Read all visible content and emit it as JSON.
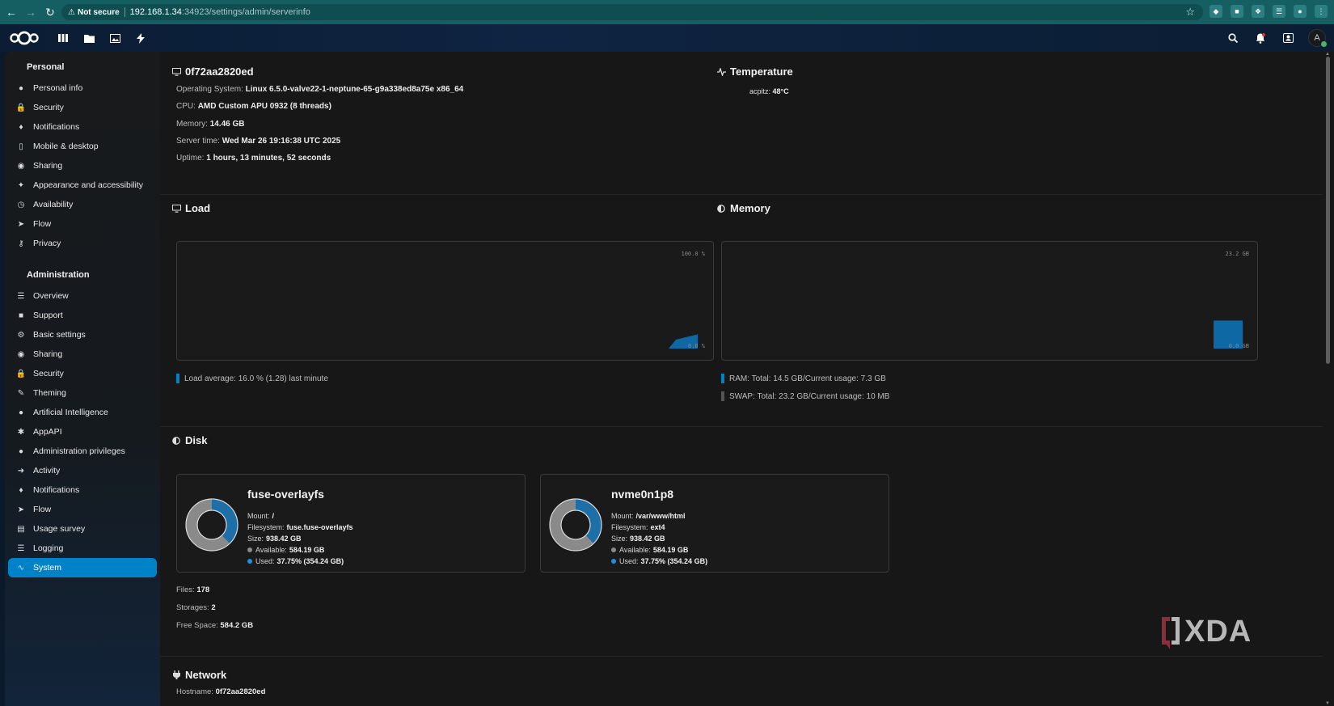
{
  "browser": {
    "security_label": "Not secure",
    "url_host": "192.168.1.34",
    "url_path": ":34923/settings/admin/serverinfo"
  },
  "header": {
    "user_initial": "A"
  },
  "sidebar": {
    "personal_title": "Personal",
    "personal_items": [
      {
        "label": "Personal info",
        "icon": "user-icon"
      },
      {
        "label": "Security",
        "icon": "lock-icon"
      },
      {
        "label": "Notifications",
        "icon": "bell-icon"
      },
      {
        "label": "Mobile & desktop",
        "icon": "phone-icon"
      },
      {
        "label": "Sharing",
        "icon": "share-icon"
      },
      {
        "label": "Appearance and accessibility",
        "icon": "accessibility-icon"
      },
      {
        "label": "Availability",
        "icon": "clock-icon"
      },
      {
        "label": "Flow",
        "icon": "flow-icon"
      },
      {
        "label": "Privacy",
        "icon": "key-icon"
      }
    ],
    "admin_title": "Administration",
    "admin_items": [
      {
        "label": "Overview",
        "icon": "sliders-icon"
      },
      {
        "label": "Support",
        "icon": "chat-icon"
      },
      {
        "label": "Basic settings",
        "icon": "gear-icon"
      },
      {
        "label": "Sharing",
        "icon": "share-icon"
      },
      {
        "label": "Security",
        "icon": "lock-icon"
      },
      {
        "label": "Theming",
        "icon": "brush-icon"
      },
      {
        "label": "Artificial Intelligence",
        "icon": "robot-icon"
      },
      {
        "label": "AppAPI",
        "icon": "api-icon"
      },
      {
        "label": "Administration privileges",
        "icon": "admin-user-icon"
      },
      {
        "label": "Activity",
        "icon": "bolt-icon"
      },
      {
        "label": "Notifications",
        "icon": "bell-icon"
      },
      {
        "label": "Flow",
        "icon": "flow-icon"
      },
      {
        "label": "Usage survey",
        "icon": "chart-icon"
      },
      {
        "label": "Logging",
        "icon": "list-icon"
      },
      {
        "label": "System",
        "icon": "pulse-icon",
        "active": true
      }
    ]
  },
  "system": {
    "hostname": "0f72aa2820ed",
    "os_label": "Operating System:",
    "os_value": "Linux 6.5.0-valve22-1-neptune-65-g9a338ed8a75e x86_64",
    "cpu_label": "CPU:",
    "cpu_value": "AMD Custom APU 0932 (8 threads)",
    "memory_label": "Memory:",
    "memory_value": "14.46 GB",
    "time_label": "Server time:",
    "time_value": "Wed Mar 26 19:16:38 UTC 2025",
    "uptime_label": "Uptime:",
    "uptime_value": "1 hours, 13 minutes, 52 seconds"
  },
  "temperature": {
    "title": "Temperature",
    "sensor_label": "acpitz:",
    "sensor_value": "48°C"
  },
  "load": {
    "title": "Load",
    "max_label": "100.0 %",
    "min_label": "0.0 %",
    "legend": "Load average: 16.0 % (1.28) last minute",
    "color": "#0082c9"
  },
  "memory": {
    "title": "Memory",
    "max_label": "23.2 GB",
    "min_label": "0.0 GB",
    "ram_legend": "RAM: Total: 14.5 GB/Current usage: 7.3 GB",
    "swap_legend": "SWAP: Total: 23.2 GB/Current usage: 10 MB",
    "ram_color": "#0082c9",
    "swap_color": "#555555"
  },
  "chart_data": [
    {
      "type": "area",
      "title": "Load",
      "ylim": [
        0,
        100
      ],
      "y_max_label": "100.0 %",
      "y_min_label": "0.0 %",
      "series": [
        {
          "values": [
            0,
            10,
            12,
            14,
            16
          ]
        }
      ]
    },
    {
      "type": "area",
      "title": "Memory",
      "ylim": [
        0,
        23.2
      ],
      "y_max_label": "23.2 GB",
      "y_min_label": "0.0 GB",
      "series": [
        {
          "values": [
            7.3,
            7.3,
            7.3
          ]
        }
      ]
    },
    {
      "type": "pie",
      "title": "fuse-overlayfs",
      "categories": [
        "Available",
        "Used"
      ],
      "values": [
        62.25,
        37.75
      ]
    },
    {
      "type": "pie",
      "title": "nvme0n1p8",
      "categories": [
        "Available",
        "Used"
      ],
      "values": [
        62.25,
        37.75
      ]
    }
  ],
  "disk": {
    "title": "Disk",
    "cards": [
      {
        "name": "fuse-overlayfs",
        "mount_label": "Mount:",
        "mount": "/",
        "fs_label": "Filesystem:",
        "fs": "fuse.fuse-overlayfs",
        "size_label": "Size:",
        "size": "938.42 GB",
        "avail_label": "Available:",
        "avail": "584.19 GB",
        "used_label": "Used:",
        "used": "37.75% (354.24 GB)",
        "used_fraction": 0.3775
      },
      {
        "name": "nvme0n1p8",
        "mount_label": "Mount:",
        "mount": "/var/www/html",
        "fs_label": "Filesystem:",
        "fs": "ext4",
        "size_label": "Size:",
        "size": "938.42 GB",
        "avail_label": "Available:",
        "avail": "584.19 GB",
        "used_label": "Used:",
        "used": "37.75% (354.24 GB)",
        "used_fraction": 0.3775
      }
    ],
    "files_label": "Files:",
    "files": "178",
    "storages_label": "Storages:",
    "storages": "2",
    "free_label": "Free Space:",
    "free": "584.2 GB",
    "used_color": "#1e6fa8",
    "avail_color": "#8a8a8a"
  },
  "network": {
    "title": "Network",
    "hostname_label": "Hostname:",
    "hostname": "0f72aa2820ed"
  },
  "watermark": {
    "text": "XDA"
  }
}
